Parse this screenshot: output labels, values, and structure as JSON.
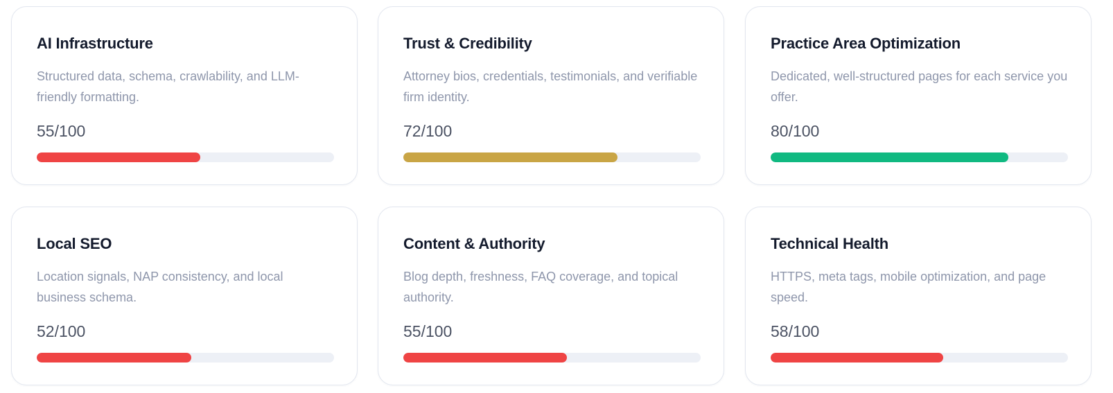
{
  "cards": [
    {
      "title": "AI Infrastructure",
      "description": "Structured data, schema, crawlability, and LLM-friendly formatting.",
      "score_text": "55/100",
      "score": 55,
      "bar_color": "#ef4444"
    },
    {
      "title": "Trust & Credibility",
      "description": "Attorney bios, credentials, testimonials, and verifiable firm identity.",
      "score_text": "72/100",
      "score": 72,
      "bar_color": "#c9a545"
    },
    {
      "title": "Practice Area Optimization",
      "description": "Dedicated, well-structured pages for each service you offer.",
      "score_text": "80/100",
      "score": 80,
      "bar_color": "#10b981"
    },
    {
      "title": "Local SEO",
      "description": "Location signals, NAP consistency, and local business schema.",
      "score_text": "52/100",
      "score": 52,
      "bar_color": "#ef4444"
    },
    {
      "title": "Content & Authority",
      "description": "Blog depth, freshness, FAQ coverage, and topical authority.",
      "score_text": "55/100",
      "score": 55,
      "bar_color": "#ef4444"
    },
    {
      "title": "Technical Health",
      "description": "HTTPS, meta tags, mobile optimization, and page speed.",
      "score_text": "58/100",
      "score": 58,
      "bar_color": "#ef4444"
    }
  ],
  "colors": {
    "track": "#edf0f6",
    "title": "#141b2d",
    "description": "#8e96ab",
    "score": "#4b5263"
  }
}
